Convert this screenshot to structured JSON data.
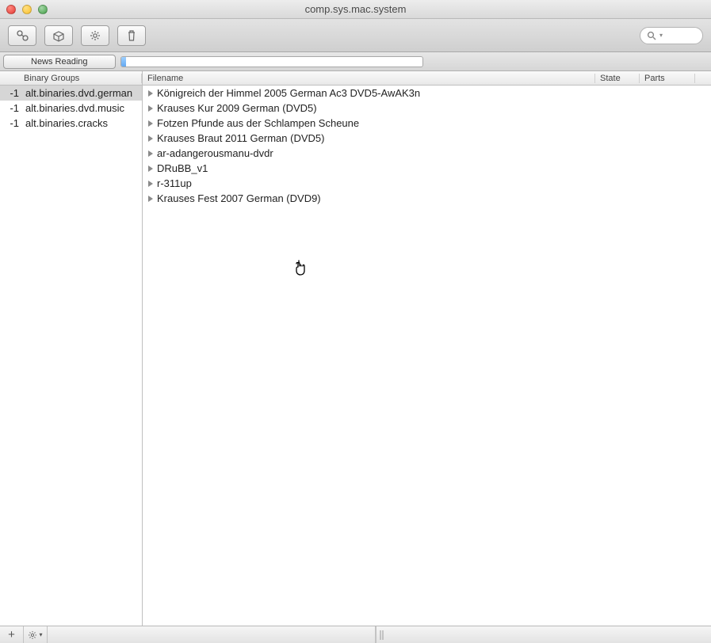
{
  "window": {
    "title": "comp.sys.mac.system"
  },
  "toolbar": {
    "icons": [
      "connect-icon",
      "package-icon",
      "gear-icon",
      "trash-icon"
    ]
  },
  "search": {
    "placeholder": ""
  },
  "subtoolbar": {
    "news_reading_label": "News Reading"
  },
  "sidebar": {
    "header": "Binary Groups",
    "items": [
      {
        "count": "-1",
        "name": "alt.binaries.dvd.german",
        "selected": true
      },
      {
        "count": "-1",
        "name": "alt.binaries.dvd.music",
        "selected": false
      },
      {
        "count": "-1",
        "name": "alt.binaries.cracks",
        "selected": false
      }
    ]
  },
  "main": {
    "headers": {
      "filename": "Filename",
      "state": "State",
      "parts": "Parts"
    },
    "rows": [
      {
        "filename": "Königreich der Himmel 2005 German Ac3 DVD5-AwAK3n"
      },
      {
        "filename": "Krauses Kur  2009 German (DVD5)"
      },
      {
        "filename": "Fotzen Pfunde aus der Schlampen Scheune"
      },
      {
        "filename": "Krauses Braut  2011 German (DVD5)"
      },
      {
        "filename": "ar-adangerousmanu-dvdr"
      },
      {
        "filename": "DRuBB_v1"
      },
      {
        "filename": "r-311up"
      },
      {
        "filename": "Krauses Fest  2007 German (DVD9)"
      }
    ]
  },
  "statusbar": {
    "add": "+",
    "gear": "✻",
    "menu": "▾"
  }
}
